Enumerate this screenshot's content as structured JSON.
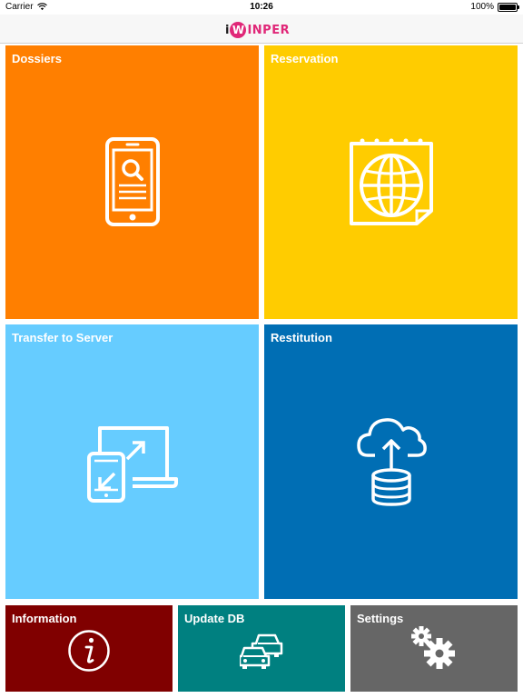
{
  "status_bar": {
    "carrier": "Carrier",
    "time": "10:26",
    "battery": "100%",
    "battery_level": 1.0
  },
  "header": {
    "logo_text_i": "i",
    "logo_text_w": "W",
    "logo_text_rest": "INPER",
    "logo_alt": "iWinPer"
  },
  "tiles": {
    "dossiers": {
      "label": "Dossiers",
      "icon": "phone-search-icon",
      "color": "#ff7f00"
    },
    "reservation": {
      "label": "Reservation",
      "icon": "calendar-globe-icon",
      "color": "#ffcc00"
    },
    "transfer": {
      "label": "Transfer to Server",
      "icon": "device-transfer-icon",
      "color": "#66ccff"
    },
    "restitution": {
      "label": "Restitution",
      "icon": "cloud-database-icon",
      "color": "#006eb4"
    },
    "information": {
      "label": "Information",
      "icon": "info-icon",
      "color": "#800000"
    },
    "update_db": {
      "label": "Update DB",
      "icon": "cars-icon",
      "color": "#008080"
    },
    "settings": {
      "label": "Settings",
      "icon": "gears-icon",
      "color": "#666666"
    }
  }
}
